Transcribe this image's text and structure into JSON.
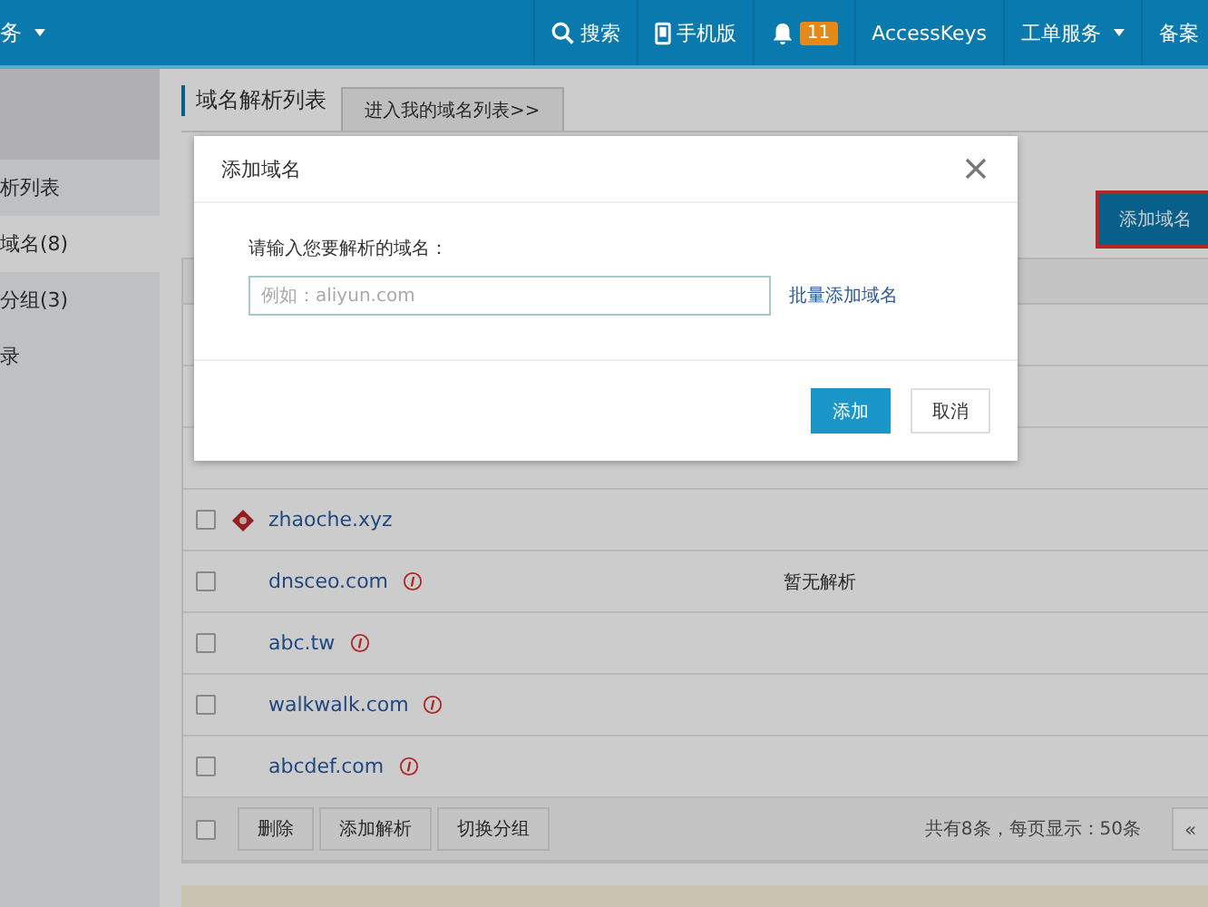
{
  "topbar": {
    "brand_cut": "务",
    "items": [
      {
        "kind": "search",
        "label": "搜索"
      },
      {
        "kind": "phone",
        "label": "手机版"
      },
      {
        "kind": "bell",
        "badge": "11"
      },
      {
        "kind": "text",
        "label": "AccessKeys"
      },
      {
        "kind": "dropdown",
        "label": "工单服务"
      },
      {
        "kind": "text",
        "label": "备案"
      }
    ]
  },
  "sidebar": {
    "items": [
      {
        "label": "析列表",
        "selected": false
      },
      {
        "label": "域名(8)",
        "selected": true
      },
      {
        "label": "分组(3)",
        "selected": false
      },
      {
        "label": "录",
        "selected": false
      }
    ]
  },
  "page": {
    "title": "域名解析列表",
    "tab_link": "进入我的域名列表>>",
    "add_button": "添加域名"
  },
  "table": {
    "rows": [
      {
        "kind": "group",
        "name": "zhaoche.xyz",
        "checked": false,
        "children": [
          {
            "kind": "domain",
            "name": "dnsceo.com",
            "checked": false,
            "warning": true,
            "status": "暂无解析"
          },
          {
            "kind": "domain",
            "name": "abc.tw",
            "checked": false,
            "warning": true
          },
          {
            "kind": "domain",
            "name": "walkwalk.com",
            "checked": false,
            "warning": true
          },
          {
            "kind": "domain",
            "name": "abcdef.com",
            "checked": false,
            "warning": true
          }
        ]
      }
    ],
    "footer": {
      "checked": false,
      "buttons": [
        "删除",
        "添加解析",
        "切换分组"
      ],
      "summary": "共有8条，每页显示：50条",
      "pager": "«"
    }
  },
  "dialog": {
    "title": "添加域名",
    "label": "请输入您要解析的域名：",
    "placeholder": "例如：aliyun.com",
    "link": "批量添加域名",
    "buttons": [
      {
        "kind": "primary",
        "label": "添加"
      },
      {
        "kind": "default",
        "label": "取消"
      }
    ]
  }
}
